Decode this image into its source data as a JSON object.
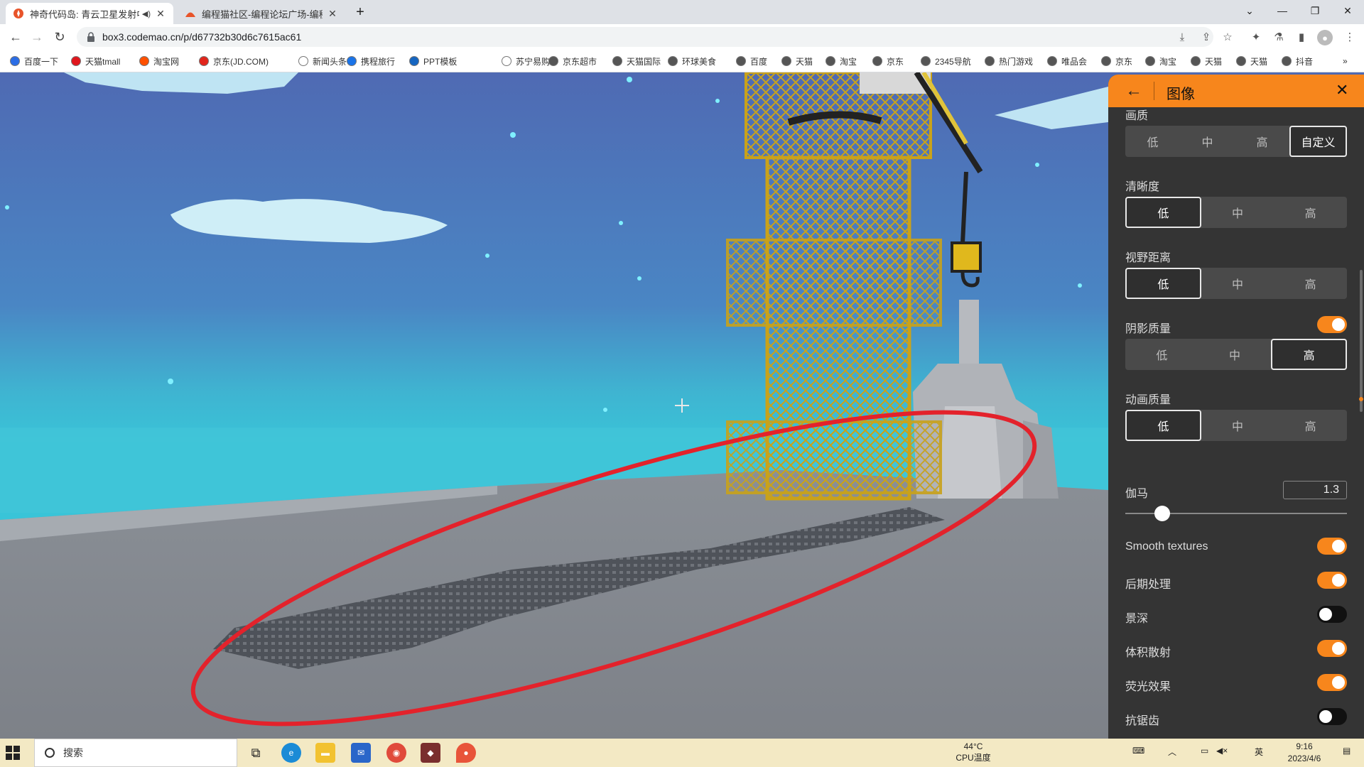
{
  "browser": {
    "tabs": [
      {
        "title": "神奇代码岛: 青云卫星发射中",
        "active": true,
        "muted_icon": "speaker-icon"
      },
      {
        "title": "编程猫社区-编程论坛广场-编程学",
        "active": false
      }
    ],
    "new_tab_symbol": "+",
    "url": "box3.codemao.cn/p/d67732b30d6c7615ac61"
  },
  "bookmarks": [
    {
      "label": "百度一下",
      "color": "#2b6de5"
    },
    {
      "label": "天猫tmall",
      "color": "#e0161d"
    },
    {
      "label": "淘宝网",
      "color": "#ff5000"
    },
    {
      "label": "京东(JD.COM)",
      "color": "#e1251b"
    },
    {
      "label": "新闻头条",
      "color": "#ffffff"
    },
    {
      "label": "携程旅行",
      "color": "#1a73e8"
    },
    {
      "label": "PPT模板",
      "color": "#1565c0"
    },
    {
      "label": "苏宁易购",
      "color": "#ffffff"
    },
    {
      "label": "京东超市",
      "color": "#555555"
    },
    {
      "label": "天猫国际",
      "color": "#555555"
    },
    {
      "label": "环球美食",
      "color": "#555555"
    },
    {
      "label": "百度",
      "color": "#555555"
    },
    {
      "label": "天猫",
      "color": "#555555"
    },
    {
      "label": "淘宝",
      "color": "#555555"
    },
    {
      "label": "京东",
      "color": "#555555"
    },
    {
      "label": "2345导航",
      "color": "#555555"
    },
    {
      "label": "热门游戏",
      "color": "#555555"
    },
    {
      "label": "唯品会",
      "color": "#555555"
    },
    {
      "label": "京东",
      "color": "#555555"
    },
    {
      "label": "淘宝",
      "color": "#555555"
    },
    {
      "label": "天猫",
      "color": "#555555"
    },
    {
      "label": "天猫",
      "color": "#555555"
    },
    {
      "label": "抖音",
      "color": "#555555"
    }
  ],
  "panel": {
    "title": "图像",
    "accent": "#f7861c",
    "sections": [
      {
        "label": "画质",
        "options": [
          "低",
          "中",
          "高",
          "自定义"
        ],
        "selected": 3
      },
      {
        "label": "清晰度",
        "options": [
          "低",
          "中",
          "高"
        ],
        "selected": 0
      },
      {
        "label": "视野距离",
        "options": [
          "低",
          "中",
          "高"
        ],
        "selected": 0
      },
      {
        "label": "阴影质量",
        "options": [
          "低",
          "中",
          "高"
        ],
        "selected": 2,
        "toggle": true
      },
      {
        "label": "动画质量",
        "options": [
          "低",
          "中",
          "高"
        ],
        "selected": 0
      }
    ],
    "gamma": {
      "label": "伽马",
      "value": "1.3",
      "fraction": 0.167
    },
    "toggles": [
      {
        "label": "Smooth textures",
        "on": true
      },
      {
        "label": "后期处理",
        "on": true
      },
      {
        "label": "景深",
        "on": false
      },
      {
        "label": "体积散射",
        "on": true
      },
      {
        "label": "荧光效果",
        "on": true
      },
      {
        "label": "抗锯齿",
        "on": false
      }
    ]
  },
  "taskbar": {
    "search_placeholder": "搜索",
    "cpu_temp": "44°C",
    "cpu_label": "CPU温度",
    "time": "9:16",
    "date": "2023/4/6",
    "ime": "英"
  }
}
